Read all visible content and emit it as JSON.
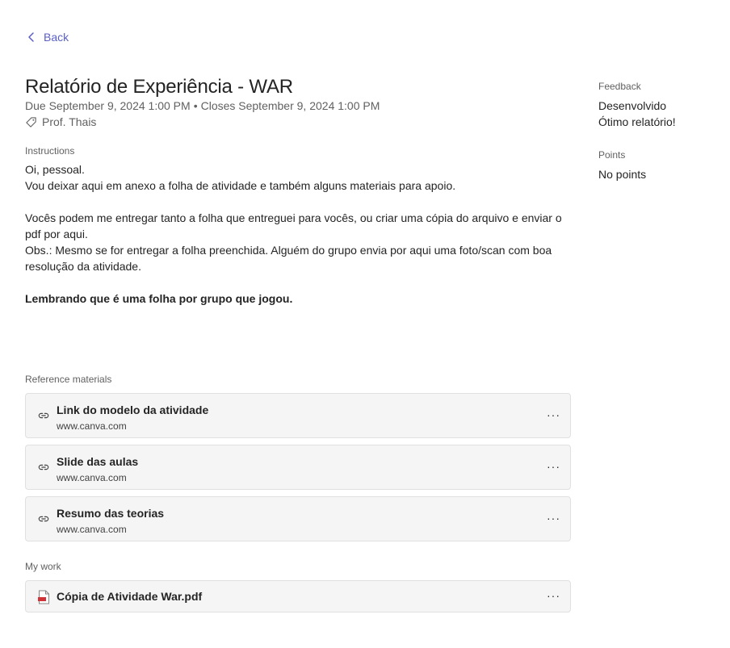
{
  "nav": {
    "back_label": "Back"
  },
  "assignment": {
    "title": "Relatório de Experiência - WAR",
    "due": "Due September 9, 2024 1:00 PM",
    "separator": "•",
    "closes": "Closes September 9, 2024 1:00 PM",
    "teacher": "Prof. Thais"
  },
  "instructions": {
    "label": "Instructions",
    "lines": [
      "Oi, pessoal.",
      "Vou deixar aqui em anexo a folha de atividade e também alguns materiais para apoio.",
      "Vocês podem me entregar tanto a folha que entreguei para vocês, ou criar uma cópia do arquivo e enviar o pdf por aqui.",
      "Obs.: Mesmo se for entregar a folha preenchida. Alguém do grupo envia por aqui uma foto/scan com boa resolução da atividade.",
      "Lembrando que é uma folha por grupo que jogou."
    ]
  },
  "reference": {
    "label": "Reference materials",
    "items": [
      {
        "name": "Link do modelo da atividade",
        "url": "www.canva.com",
        "icon": "link-icon"
      },
      {
        "name": "Slide das aulas",
        "url": "www.canva.com",
        "icon": "link-icon"
      },
      {
        "name": "Resumo das teorias",
        "url": "www.canva.com",
        "icon": "link-icon"
      }
    ],
    "more_label": "···"
  },
  "my_work": {
    "label": "My work",
    "file": {
      "name": "Cópia de Atividade War.pdf",
      "icon": "pdf-file-icon"
    },
    "more_label": "···"
  },
  "feedback": {
    "label": "Feedback",
    "lines": [
      "Desenvolvido",
      "Ótimo relatório!"
    ]
  },
  "points": {
    "label": "Points",
    "value": "No points"
  },
  "colors": {
    "accent": "#5b5fc7",
    "pdf": "#d13438",
    "card_bg": "#f5f5f5"
  }
}
